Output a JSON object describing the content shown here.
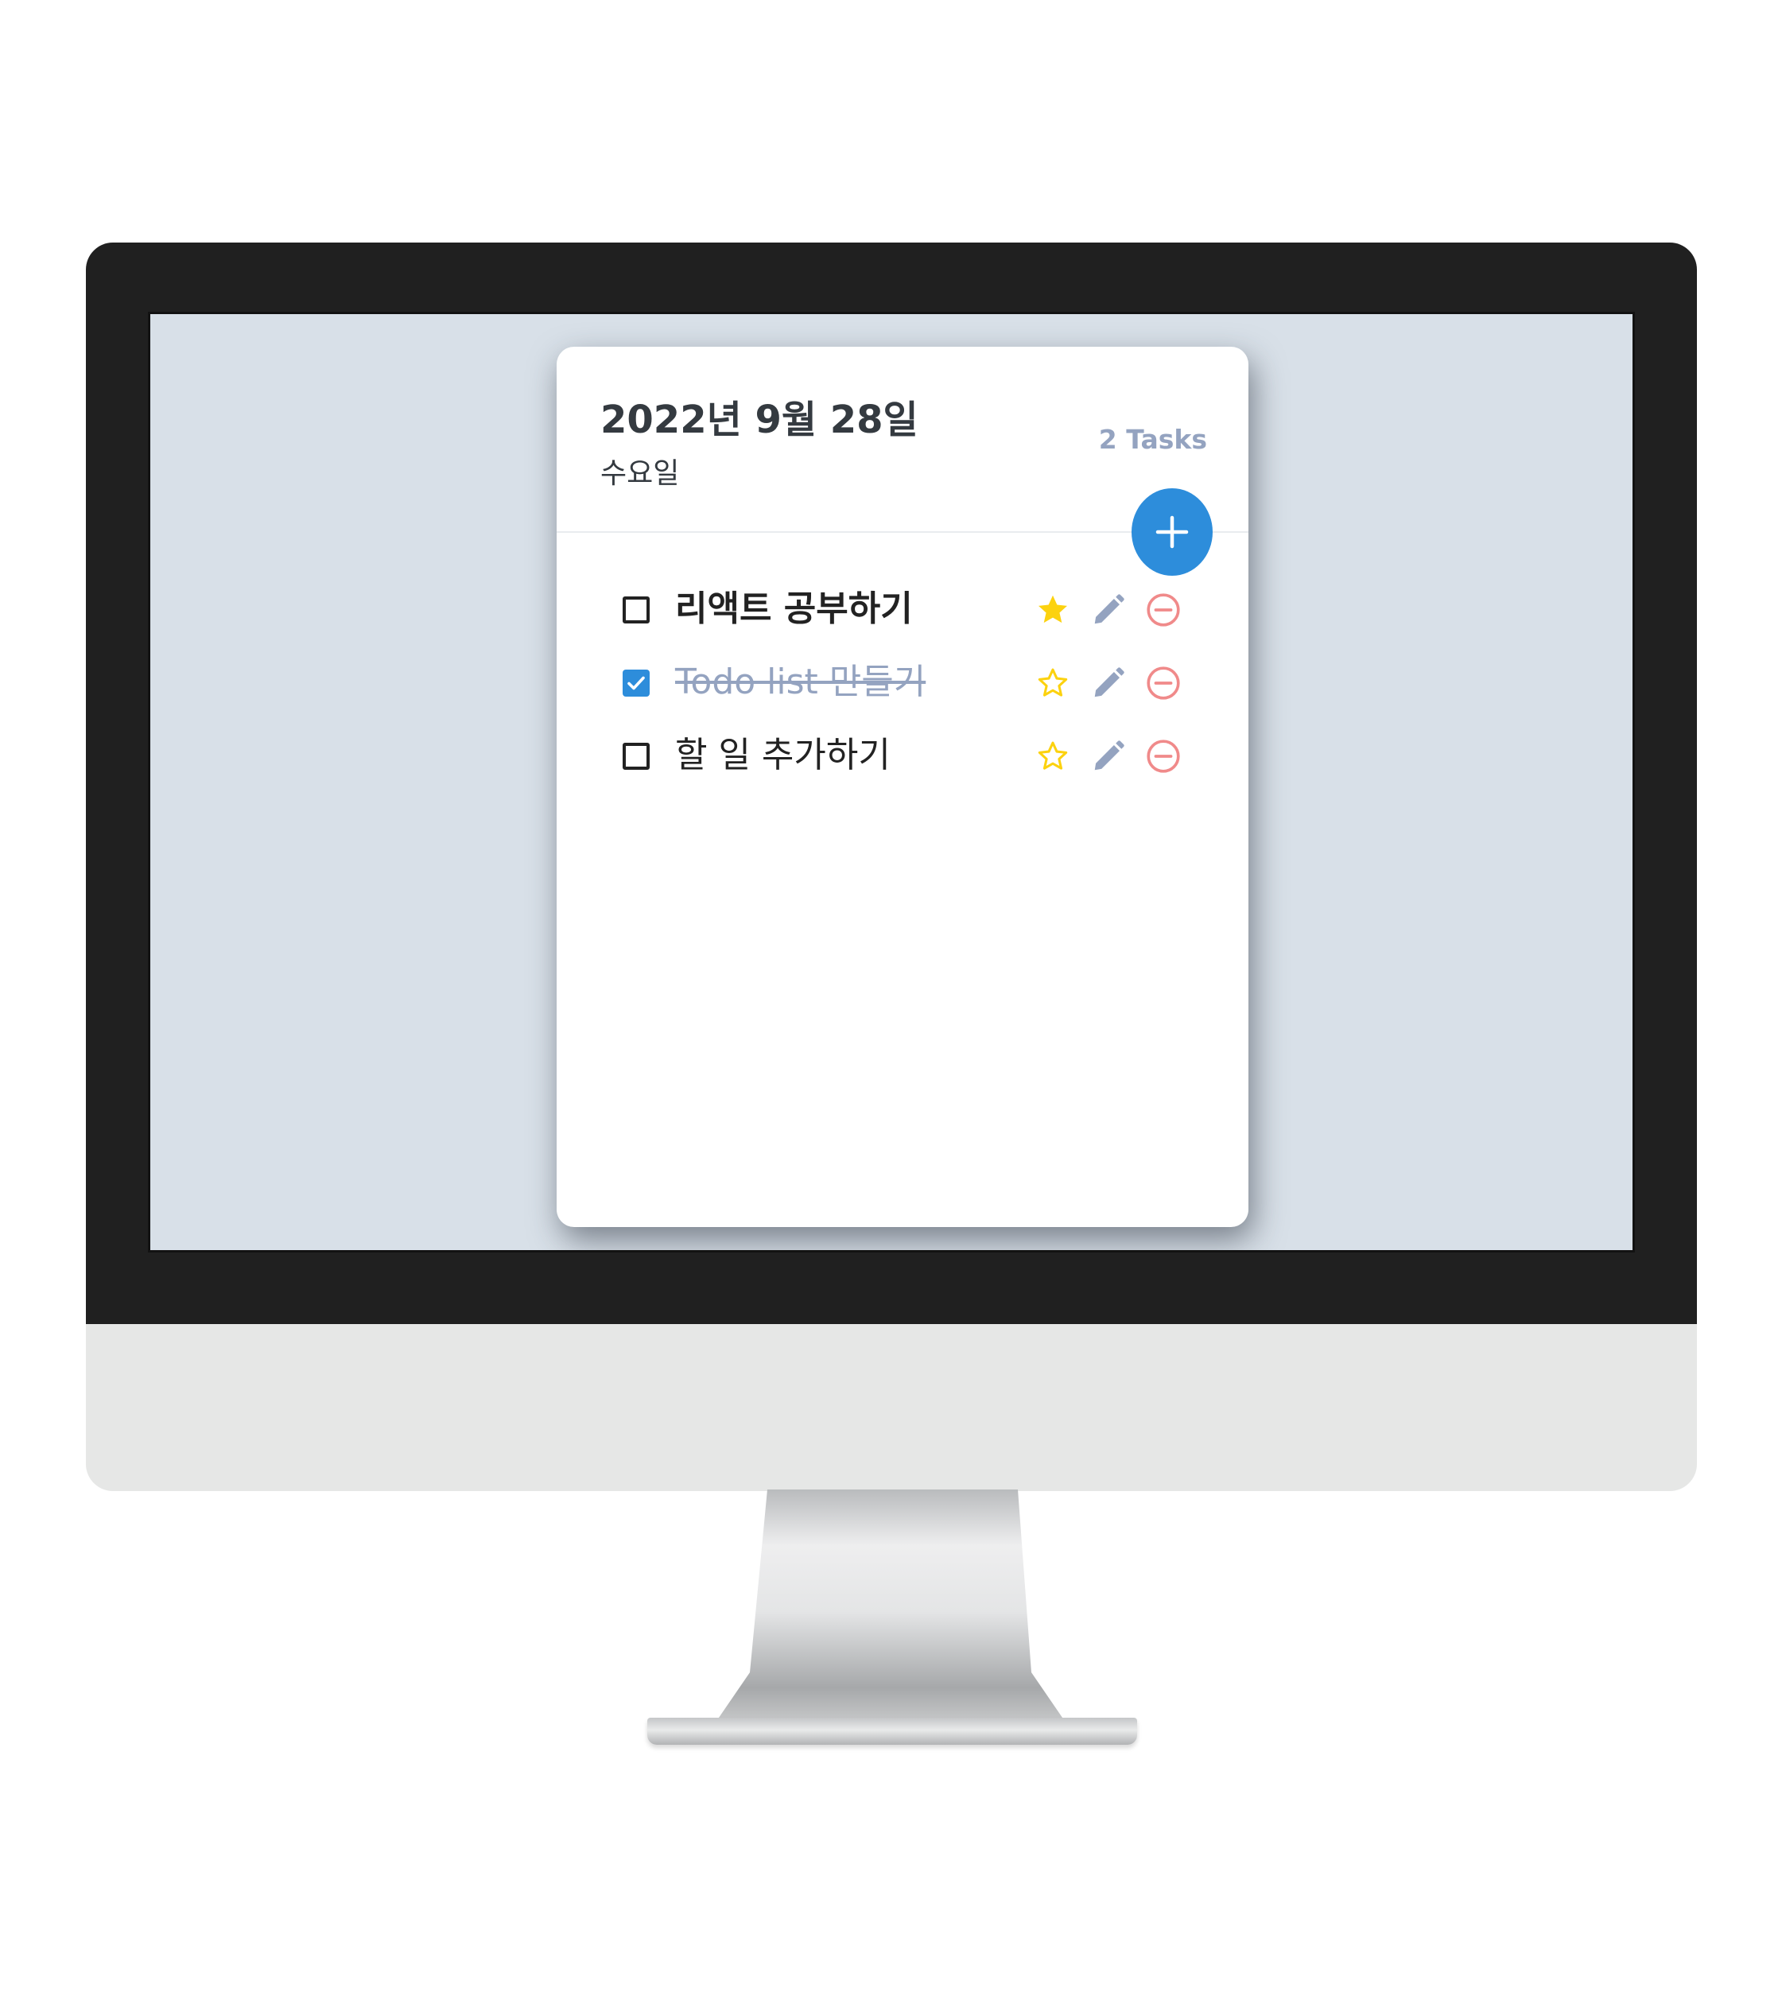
{
  "header": {
    "date": "2022년 9월 28일",
    "day": "수요일",
    "tasks_left": "2 Tasks"
  },
  "todos": [
    {
      "text": "리액트 공부하기",
      "done": false,
      "important": true
    },
    {
      "text": "Todo list 만들기",
      "done": true,
      "important": false
    },
    {
      "text": "할 일 추가하기",
      "done": false,
      "important": false
    }
  ],
  "colors": {
    "accent": "#2d8ddb",
    "star": "#fcd20f",
    "pencil": "#94a3c0",
    "remove": "#f08a8a",
    "screen_bg": "#d8e0e8"
  },
  "icons": {
    "add": "plus-icon",
    "important": "star-icon",
    "edit": "pencil-icon",
    "delete": "minus-circle-icon",
    "checkbox": "checkbox-icon"
  }
}
